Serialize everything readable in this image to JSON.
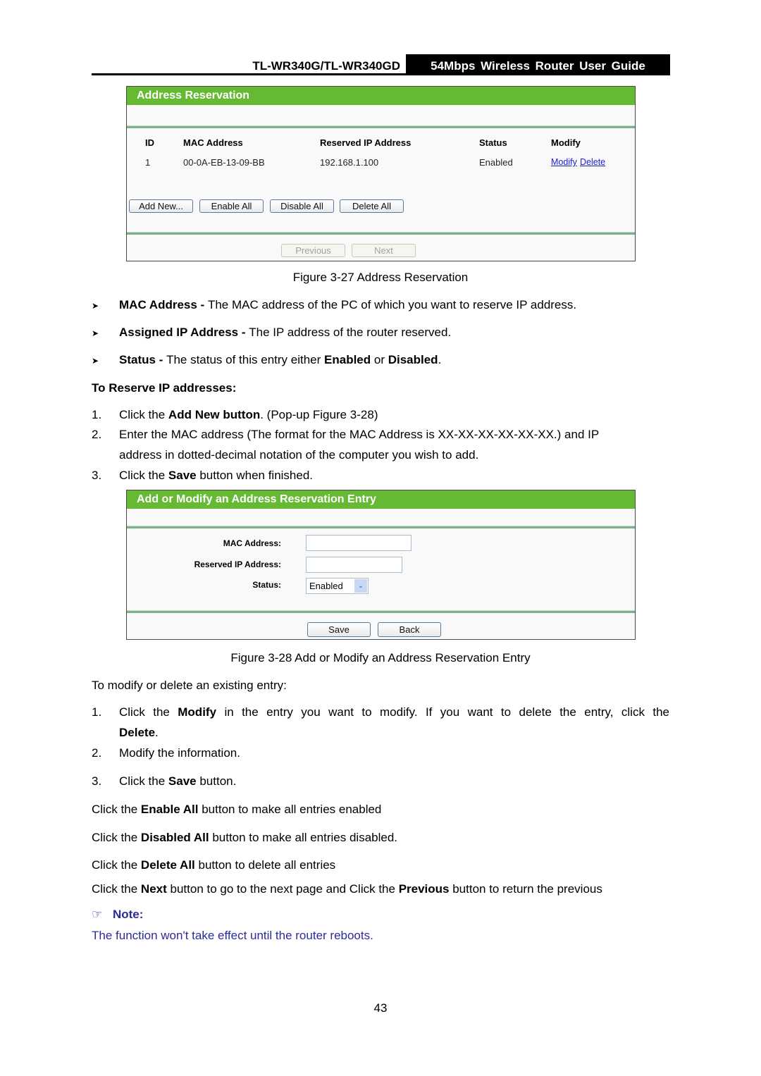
{
  "header": {
    "model": "TL-WR340G/TL-WR340GD",
    "guide_title": "54Mbps Wireless Router User Guide"
  },
  "figure27": {
    "panel_title": "Address Reservation",
    "columns": [
      "ID",
      "MAC Address",
      "Reserved IP Address",
      "Status",
      "Modify"
    ],
    "rows": [
      {
        "id": "1",
        "mac": "00-0A-EB-13-09-BB",
        "ip": "192.168.1.100",
        "status": "Enabled",
        "modify_link": "Modify",
        "delete_link": "Delete"
      }
    ],
    "buttons": {
      "add_new": "Add New...",
      "enable_all": "Enable All",
      "disable_all": "Disable All",
      "delete_all": "Delete All"
    },
    "nav": {
      "previous": "Previous",
      "next": "Next"
    },
    "caption": "Figure 3-27 Address Reservation"
  },
  "definitions": [
    {
      "term": "MAC Address - ",
      "desc": "The MAC address of the PC of which you want to reserve IP address."
    },
    {
      "term": "Assigned IP Address - ",
      "desc": "The IP address of the router reserved."
    },
    {
      "term": "Status - ",
      "desc_pre": "The status of this entry either ",
      "b1": "Enabled",
      "mid": " or ",
      "b2": "Disabled",
      "end": "."
    }
  ],
  "reserve_heading": "To Reserve IP addresses:",
  "reserve_steps": [
    {
      "num": "1.",
      "pre": "Click the ",
      "bold": "Add New button",
      "post": ". (Pop-up Figure 3-28)"
    },
    {
      "num": "2.",
      "line1": "Enter the MAC address (The format for the MAC Address is XX-XX-XX-XX-XX-XX.) and IP",
      "line2": "address in dotted-decimal notation of the computer you wish to add."
    },
    {
      "num": "3.",
      "pre": "Click the ",
      "bold": "Save",
      "post": " button when finished."
    }
  ],
  "figure28": {
    "panel_title": "Add or Modify an Address Reservation Entry",
    "fields": {
      "mac_label": "MAC Address:",
      "mac_value": "",
      "ip_label": "Reserved IP Address:",
      "ip_value": "",
      "status_label": "Status:",
      "status_value": "Enabled"
    },
    "buttons": {
      "save": "Save",
      "back": "Back"
    },
    "caption": "Figure 3-28 Add or Modify an Address Reservation Entry"
  },
  "modify_intro": "To modify or delete an existing entry:",
  "modify_steps": [
    {
      "num": "1.",
      "pre": "Click the ",
      "bold": "Modify",
      "post": " in the entry you want to modify. If you want to delete the entry, click the",
      "line2_bold": "Delete",
      "line2_post": "."
    },
    {
      "num": "2.",
      "text": "Modify the information."
    },
    {
      "num": "3.",
      "pre": "Click the ",
      "bold": "Save",
      "post": " button."
    }
  ],
  "paragraphs": [
    {
      "pre": "Click the ",
      "bold": "Enable All",
      "post": " button to make all entries enabled"
    },
    {
      "pre": "Click the ",
      "bold": "Disabled All",
      "post": " button to make all entries disabled."
    },
    {
      "pre": "Click the ",
      "bold": "Delete All",
      "post": " button to delete all entries"
    },
    {
      "pre": "Click the ",
      "bold": "Next",
      "mid": " button to go to the next page and Click the ",
      "bold2": "Previous",
      "post": " button to return the previous"
    }
  ],
  "note": {
    "icon": "pointing-hand-icon",
    "label": "Note:",
    "text": "The function won't take effect until the router reboots."
  },
  "page_number": "43",
  "colors": {
    "panel_header": "#66b933",
    "link": "#1b1ecf",
    "note": "#2b2b9a"
  }
}
